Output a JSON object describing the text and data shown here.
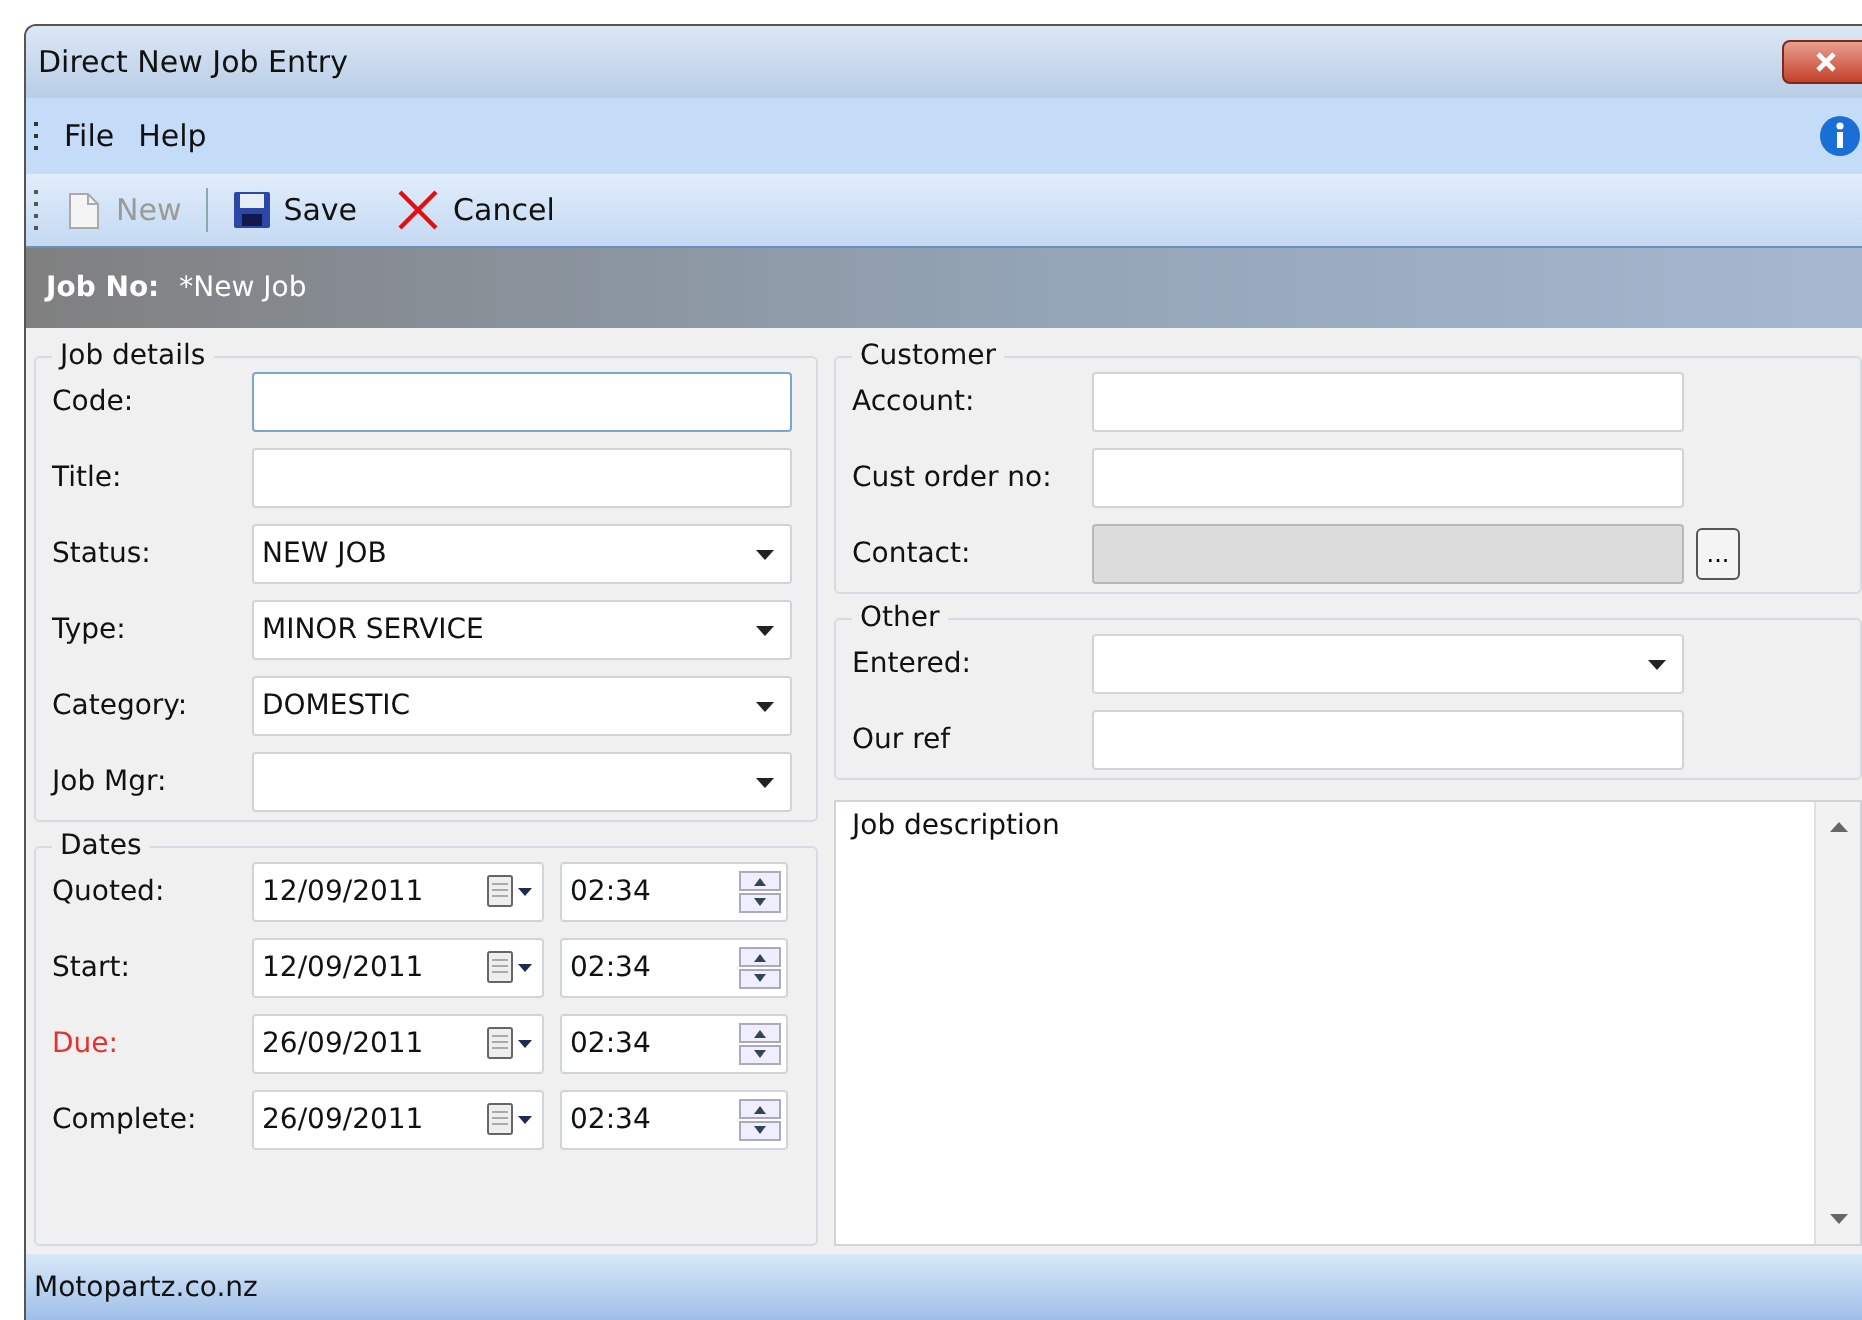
{
  "window": {
    "title": "Direct New Job Entry"
  },
  "menu": [
    "File",
    "Help"
  ],
  "toolbar": [
    {
      "kind": "new",
      "label": "New",
      "disabled": true
    },
    {
      "kind": "save",
      "label": "Save",
      "disabled": false
    },
    {
      "kind": "cancel",
      "label": "Cancel",
      "disabled": false
    }
  ],
  "job_header": {
    "label": "Job No:",
    "value": "*New Job"
  },
  "job_details": {
    "title": "Job details",
    "fields": [
      {
        "kind": "text",
        "label": "Code:",
        "focused": true
      },
      {
        "kind": "text",
        "label": "Title:",
        "focused": false
      },
      {
        "kind": "dropdown",
        "label": "Status:",
        "value": "NEW JOB"
      },
      {
        "kind": "dropdown",
        "label": "Type:",
        "value": "MINOR SERVICE"
      },
      {
        "kind": "dropdown",
        "label": "Category:",
        "value": "DOMESTIC"
      },
      {
        "kind": "dropdown",
        "label": "Job Mgr:"
      }
    ]
  },
  "customer": {
    "title": "Customer",
    "fields": [
      {
        "kind": "text",
        "label": "Account:",
        "disabled": false
      },
      {
        "kind": "text",
        "label": "Cust order no:",
        "disabled": false
      },
      {
        "kind": "lookup",
        "label": "Contact:",
        "disabled": true,
        "button": "..."
      }
    ]
  },
  "other": {
    "title": "Other",
    "fields": [
      {
        "kind": "dropdown",
        "label": "Entered:"
      },
      {
        "kind": "text",
        "label": "Our ref"
      }
    ]
  },
  "dates": {
    "title": "Dates",
    "rows": [
      {
        "label": "Quoted:",
        "date": "12/09/2011",
        "time": "02:34",
        "overdue": false
      },
      {
        "label": "Start:",
        "date": "12/09/2011",
        "time": "02:34",
        "overdue": false
      },
      {
        "label": "Due:",
        "date": "26/09/2011",
        "time": "02:34",
        "overdue": true
      },
      {
        "label": "Complete:",
        "date": "26/09/2011",
        "time": "02:34",
        "overdue": false
      }
    ]
  },
  "job_description": {
    "value": "Job description"
  },
  "status_bar": {
    "text": "Motopartz.co.nz"
  }
}
